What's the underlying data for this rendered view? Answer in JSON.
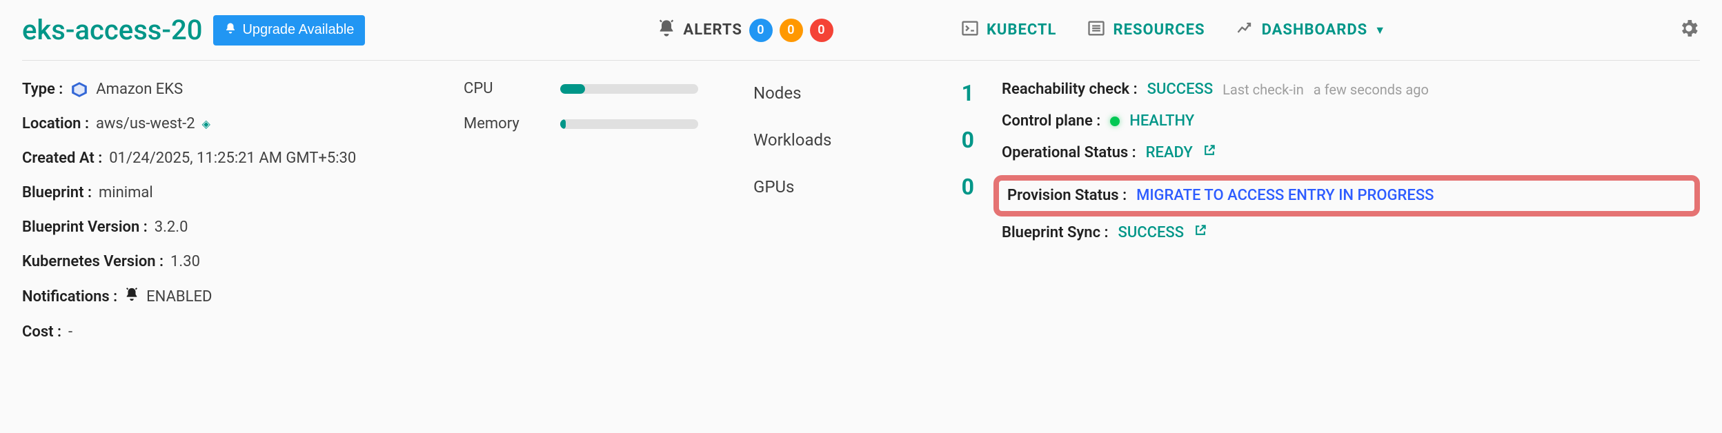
{
  "header": {
    "cluster_name": "eks-access-20",
    "upgrade_label": "Upgrade Available",
    "alerts_label": "ALERTS",
    "alerts": {
      "info": "0",
      "warn": "0",
      "crit": "0"
    },
    "nav": {
      "kubectl": "KUBECTL",
      "resources": "RESOURCES",
      "dashboards": "DASHBOARDS"
    }
  },
  "details": {
    "type_label": "Type :",
    "type_value": "Amazon EKS",
    "location_label": "Location :",
    "location_value": "aws/us-west-2",
    "created_label": "Created At :",
    "created_value": "01/24/2025, 11:25:21 AM GMT+5:30",
    "blueprint_label": "Blueprint :",
    "blueprint_value": "minimal",
    "blueprint_version_label": "Blueprint Version :",
    "blueprint_version_value": "3.2.0",
    "k8s_version_label": "Kubernetes Version :",
    "k8s_version_value": "1.30",
    "notifications_label": "Notifications :",
    "notifications_value": "ENABLED",
    "cost_label": "Cost :",
    "cost_value": "-"
  },
  "meters": {
    "cpu_label": "CPU",
    "cpu_pct": 18,
    "memory_label": "Memory",
    "memory_pct": 4
  },
  "stats": {
    "nodes_label": "Nodes",
    "nodes_value": "1",
    "workloads_label": "Workloads",
    "workloads_value": "0",
    "gpus_label": "GPUs",
    "gpus_value": "0"
  },
  "status": {
    "reachability_label": "Reachability check :",
    "reachability_value": "SUCCESS",
    "last_checkin_label": "Last check-in",
    "last_checkin_value": "a few seconds ago",
    "control_plane_label": "Control plane :",
    "control_plane_value": "HEALTHY",
    "operational_label": "Operational Status :",
    "operational_value": "READY",
    "provision_label": "Provision Status :",
    "provision_value": "MIGRATE TO ACCESS ENTRY IN PROGRESS",
    "blueprint_sync_label": "Blueprint Sync :",
    "blueprint_sync_value": "SUCCESS"
  }
}
